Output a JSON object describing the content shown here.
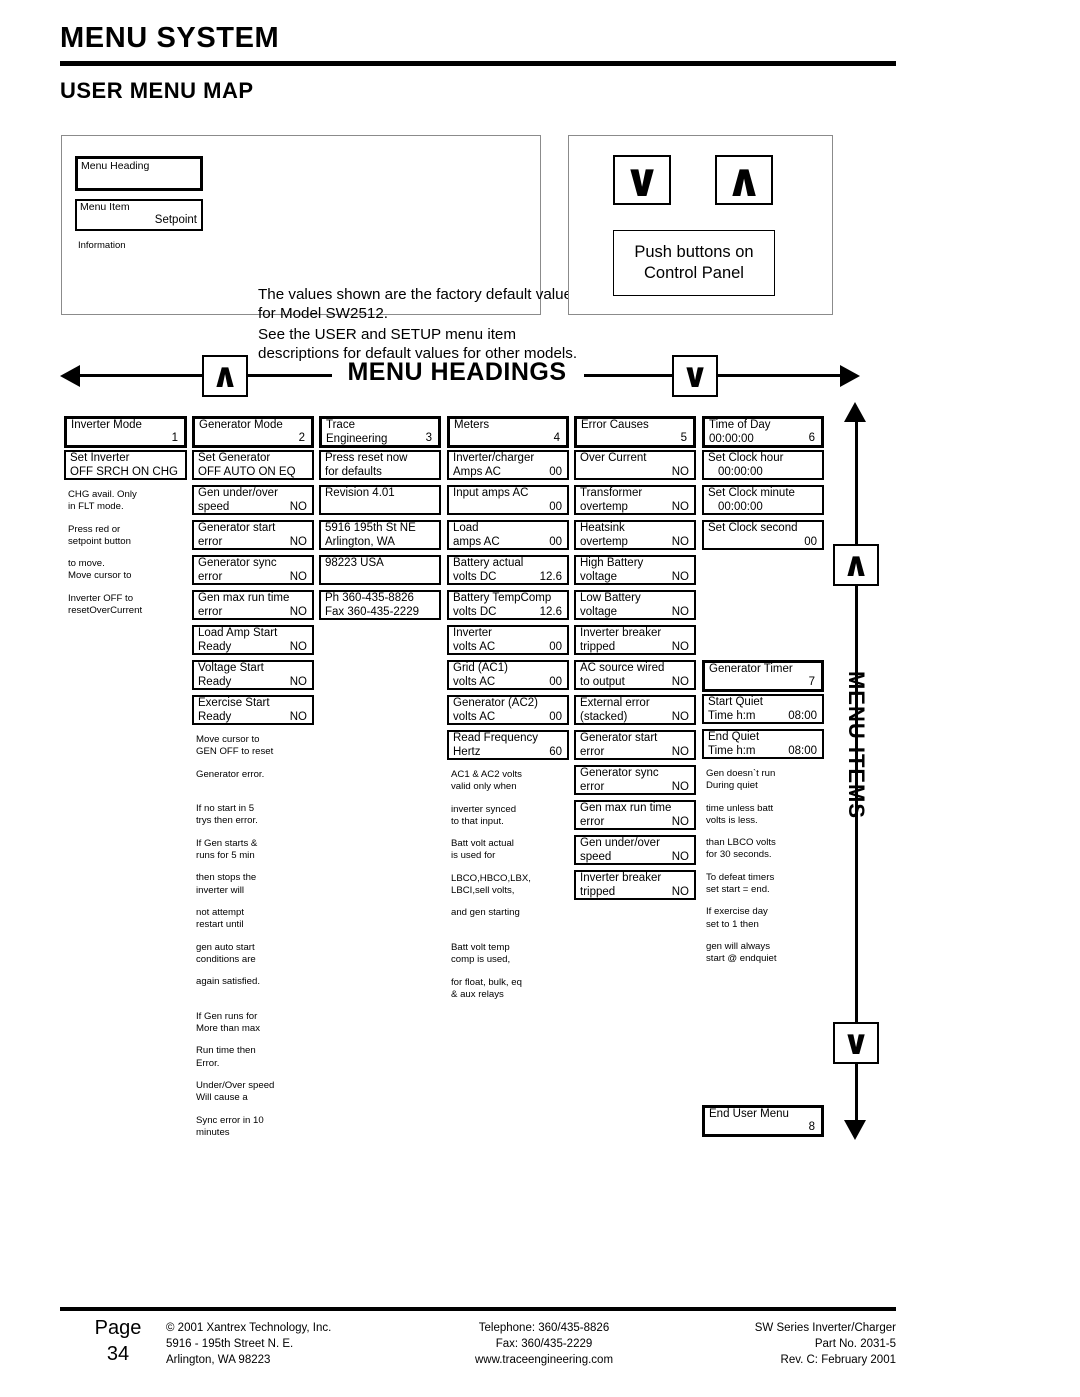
{
  "header": {
    "title": "MENU SYSTEM",
    "subtitle": "USER MENU MAP"
  },
  "legend": {
    "menu_heading_label": "Menu Heading",
    "menu_item_label": "Menu Item",
    "setpoint_label": "Setpoint",
    "information_label": "Information",
    "note_1": "The values shown are the factory default values for Model SW2512.",
    "note_2": "See the USER and SETUP menu item descriptions for default values for other models."
  },
  "buttons_panel": {
    "down_glyph": "∨",
    "up_glyph": "∧",
    "caption_line1": "Push buttons on",
    "caption_line2": "Control Panel"
  },
  "axes": {
    "headings_label": "MENU HEADINGS",
    "headings_up_glyph": "∧",
    "headings_down_glyph": "∨",
    "items_label": "MENU ITEMS",
    "items_up_glyph": "∧",
    "items_down_glyph": "∨"
  },
  "columns": [
    {
      "heading": {
        "l1": "Inverter Mode",
        "num": "1"
      },
      "items": [
        {
          "l1": "Set Inverter",
          "l2": "OFF SRCH  ON CHG"
        }
      ],
      "notes": [
        "CHG avail. Only\nin FLT mode.",
        "Press red or\nsetpoint button",
        "to move.\nMove cursor to",
        "Inverter OFF to\nresetOverCurrent"
      ]
    },
    {
      "heading": {
        "l1": "Generator Mode",
        "num": "2"
      },
      "items": [
        {
          "l1": "Set Generator",
          "l2": "OFF AUTO  ON  EQ"
        },
        {
          "l1": "Gen under/over",
          "l2": "speed",
          "val": "NO"
        },
        {
          "l1": "Generator start",
          "l2": "error",
          "val": "NO"
        },
        {
          "l1": "Generator sync",
          "l2": "error",
          "val": "NO"
        },
        {
          "l1": "Gen max run time",
          "l2": "error",
          "val": "NO"
        },
        {
          "l1": "Load Amp Start",
          "l2": "Ready",
          "val": "NO"
        },
        {
          "l1": "Voltage Start",
          "l2": "Ready",
          "val": "NO"
        },
        {
          "l1": "Exercise Start",
          "l2": "Ready",
          "val": "NO"
        }
      ],
      "notes": [
        "Move cursor to\nGEN OFF to reset",
        "Generator error.",
        "If no start in 5\ntrys then error.",
        "If Gen starts &\nruns for 5 min",
        "then stops the\n inverter will",
        "not attempt\nrestart until",
        "gen auto start\nconditions are",
        "again satisfied.",
        "If Gen runs for\nMore than max",
        "Run time then\nError.",
        "Under/Over speed\nWill cause a",
        "Sync error in 10\nminutes"
      ]
    },
    {
      "heading": {
        "l1": "Trace",
        "l2": "Engineering",
        "num": "3"
      },
      "items": [
        {
          "l1": "Press reset now",
          "l2": "for defaults"
        },
        {
          "l1": "Revision 4.01"
        },
        {
          "l1": "5916 195th St NE",
          "l2": "Arlington, WA"
        },
        {
          "l1": "98223 USA"
        },
        {
          "l1": "Ph  360-435-8826",
          "l2": "Fax 360-435-2229"
        }
      ],
      "notes": []
    },
    {
      "heading": {
        "l1": "Meters",
        "num": "4"
      },
      "items": [
        {
          "l1": "Inverter/charger",
          "l2": "Amps AC",
          "val": "00"
        },
        {
          "l1": "Input amps AC",
          "val": "00"
        },
        {
          "l1": "Load",
          "l2": "amps AC",
          "val": "00"
        },
        {
          "l1": "Battery actual",
          "l2": "volts DC",
          "val": "12.6"
        },
        {
          "l1": "Battery TempComp",
          "l2": "volts DC",
          "val": "12.6"
        },
        {
          "l1": "Inverter",
          "l2": "volts AC",
          "val": "00"
        },
        {
          "l1": "Grid (AC1)",
          "l2": "volts AC",
          "val": "00"
        },
        {
          "l1": "Generator (AC2)",
          "l2": "volts AC",
          "val": "00"
        },
        {
          "l1": "Read Frequency",
          "l2": "Hertz",
          "val": "60"
        }
      ],
      "notes": [
        "AC1 & AC2 volts\nvalid only when",
        "inverter synced\nto that input.",
        "Batt volt actual\nis used for",
        "LBCO,HBCO,LBX,\nLBCI,sell volts,",
        "and gen starting",
        "Batt volt temp\ncomp is used,",
        "for float, bulk, eq\n& aux relays"
      ]
    },
    {
      "heading": {
        "l1": "Error Causes",
        "num": "5"
      },
      "items": [
        {
          "l1": "Over Current",
          "val": "NO"
        },
        {
          "l1": "Transformer",
          "l2": "overtemp",
          "val": "NO"
        },
        {
          "l1": "Heatsink",
          "l2": "overtemp",
          "val": "NO"
        },
        {
          "l1": "High Battery",
          "l2": "voltage",
          "val": "NO"
        },
        {
          "l1": "Low Battery",
          "l2": "voltage",
          "val": "NO"
        },
        {
          "l1": "Inverter breaker",
          "l2": "tripped",
          "val": "NO"
        },
        {
          "l1": "AC source wired",
          "l2": "to output",
          "val": "NO"
        },
        {
          "l1": "External error",
          "l2": "(stacked)",
          "val": "NO"
        },
        {
          "l1": "Generator start",
          "l2": "error",
          "val": "NO"
        },
        {
          "l1": "Generator sync",
          "l2": "error",
          "val": "NO"
        },
        {
          "l1": "Gen max run time",
          "l2": "error",
          "val": "NO"
        },
        {
          "l1": "Gen under/over",
          "l2": "speed",
          "val": "NO"
        },
        {
          "l1": "Inverter breaker",
          "l2": "tripped",
          "val": "NO"
        }
      ],
      "notes": []
    },
    {
      "heading": {
        "l1": "Time of Day",
        "l2": "00:00:00",
        "num": "6"
      },
      "items": [
        {
          "l1": "Set Clock hour",
          "l2_center": "00:00:00"
        },
        {
          "l1": "Set Clock minute",
          "l2_center": "00:00:00"
        },
        {
          "l1": "Set Clock second",
          "val": "00"
        }
      ],
      "heading2": {
        "l1": "Generator Timer",
        "num": "7"
      },
      "items2": [
        {
          "l1": "Start Quiet",
          "l2": "Time  h:m",
          "val": "08:00"
        },
        {
          "l1": "End Quiet",
          "l2": "Time  h:m",
          "val": "08:00"
        }
      ],
      "notes": [
        "Gen doesn`t run\nDuring quiet",
        "time unless batt\nvolts is less.",
        "than LBCO volts\nfor 30 seconds.",
        "To defeat timers\nset start = end.",
        "If exercise day\n set to 1 then",
        "gen will always\nstart @ endquiet"
      ],
      "end_heading": {
        "l1": "End User Menu",
        "num": "8"
      }
    }
  ],
  "footer": {
    "page_label": "Page",
    "page_number": "34",
    "col1_line1": "© 2001  Xantrex Technology, Inc.",
    "col1_line2": "5916 - 195th Street N. E.",
    "col1_line3": "Arlington, WA 98223",
    "col2_line1": "Telephone: 360/435-8826",
    "col2_line2": "Fax: 360/435-2229",
    "col2_line3": "www.traceengineering.com",
    "col3_line1": "SW Series Inverter/Charger",
    "col3_line2": "Part No. 2031-5",
    "col3_line3": "Rev. C:  February 2001"
  }
}
